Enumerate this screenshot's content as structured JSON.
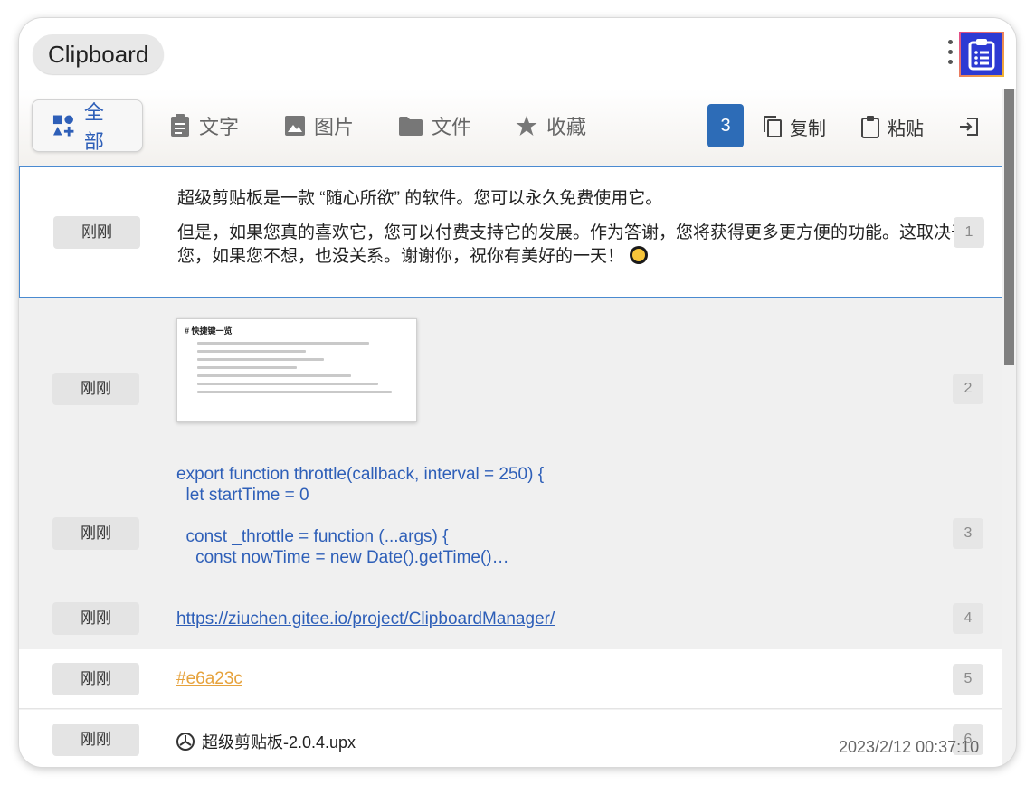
{
  "app": {
    "title": "Clipboard"
  },
  "tabs": [
    {
      "label": "全部",
      "icon": "category-icon",
      "active": true
    },
    {
      "label": "文字",
      "icon": "text-icon",
      "active": false
    },
    {
      "label": "图片",
      "icon": "image-icon",
      "active": false
    },
    {
      "label": "文件",
      "icon": "folder-icon",
      "active": false
    },
    {
      "label": "收藏",
      "icon": "star-icon",
      "active": false
    }
  ],
  "toolbar": {
    "count": "3",
    "copy_label": "复制",
    "paste_label": "粘贴"
  },
  "items": [
    {
      "time": "刚刚",
      "index": "1",
      "type": "text",
      "paragraphs": [
        "超级剪贴板是一款 “随心所欲” 的软件。您可以永久免费使用它。",
        "但是，如果您真的喜欢它，您可以付费支持它的发展。作为答谢，您将获得更多更方便的功能。这取决于您，如果您不想，也没关系。谢谢你，祝你有美好的一天！"
      ]
    },
    {
      "time": "刚刚",
      "index": "2",
      "type": "image",
      "image_heading": "# 快捷键一览"
    },
    {
      "time": "刚刚",
      "index": "3",
      "type": "code",
      "code": "export function throttle(callback, interval = 250) {\n  let startTime = 0\n\n  const _throttle = function (...args) {\n    const nowTime = new Date().getTime()…"
    },
    {
      "time": "刚刚",
      "index": "4",
      "type": "link",
      "text": "https://ziuchen.gitee.io/project/ClipboardManager/"
    },
    {
      "time": "刚刚",
      "index": "5",
      "type": "color",
      "text": "#e6a23c"
    },
    {
      "time": "刚刚",
      "index": "6",
      "type": "file",
      "text": "超级剪贴板-2.0.4.upx"
    }
  ],
  "footer": {
    "timestamp": "2023/2/12 00:37:10"
  },
  "colors": {
    "accent": "#2e5fb8",
    "badge": "#2d6cb7",
    "highlight": "#e6a23c"
  }
}
